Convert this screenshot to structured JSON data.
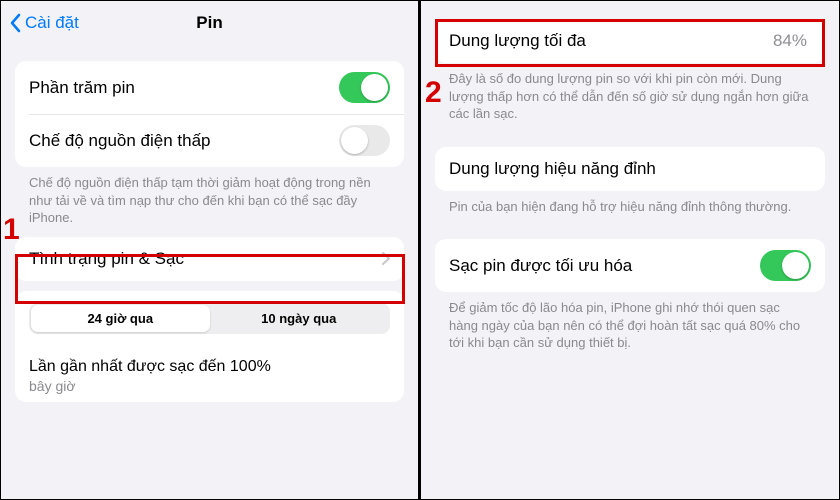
{
  "left": {
    "nav": {
      "back": "Cài đặt",
      "title": "Pin"
    },
    "rows": {
      "battery_percent": "Phần trăm pin",
      "low_power": "Chế độ nguồn điện thấp"
    },
    "low_power_desc": "Chế độ nguồn điện thấp tạm thời giảm hoạt động trong nền như tải về và tìm nạp thư cho đến khi bạn có thể sạc đầy iPhone.",
    "battery_health": "Tình trạng pin & Sạc",
    "segmented": {
      "a": "24 giờ qua",
      "b": "10 ngày qua"
    },
    "history_title": "Lần gần nhất được sạc đến 100%",
    "history_sub": "bây giờ",
    "callout": "1"
  },
  "right": {
    "max_capacity_label": "Dung lượng tối đa",
    "max_capacity_value": "84%",
    "max_capacity_desc": "Đây là số đo dung lượng pin so với khi pin còn mới. Dung lượng thấp hơn có thể dẫn đến số giờ sử dụng ngắn hơn giữa các lần sạc.",
    "peak_label": "Dung lượng hiệu năng đỉnh",
    "peak_desc": "Pin của bạn hiện đang hỗ trợ hiệu năng đỉnh thông thường.",
    "optimized_label": "Sạc pin được tối ưu hóa",
    "optimized_desc": "Để giảm tốc độ lão hóa pin, iPhone ghi nhớ thói quen sạc hàng ngày của bạn nên có thể đợi hoàn tất sạc quá 80% cho tới khi bạn cần sử dụng thiết bị.",
    "callout": "2"
  }
}
